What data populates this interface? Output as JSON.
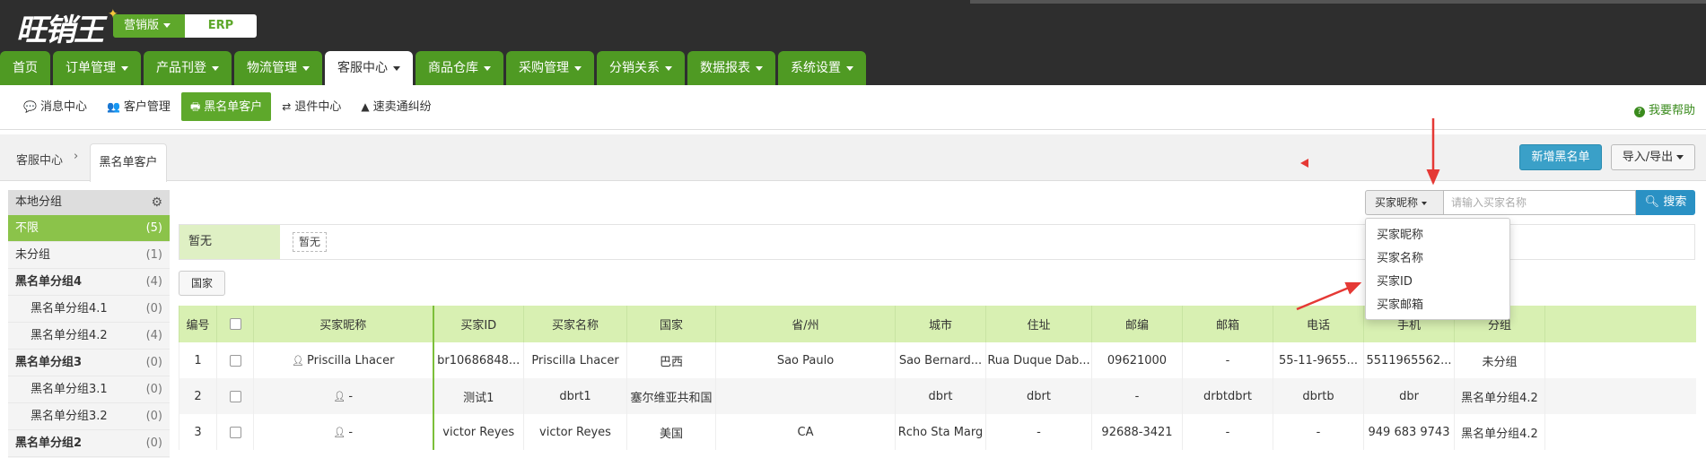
{
  "brand": {
    "logo_text": "旺销王",
    "edition": "营销版",
    "product": "ERP"
  },
  "main_nav": [
    {
      "label": "首页",
      "dropdown": false,
      "active": false
    },
    {
      "label": "订单管理",
      "dropdown": true,
      "active": false
    },
    {
      "label": "产品刊登",
      "dropdown": true,
      "active": false
    },
    {
      "label": "物流管理",
      "dropdown": true,
      "active": false
    },
    {
      "label": "客服中心",
      "dropdown": true,
      "active": true
    },
    {
      "label": "商品仓库",
      "dropdown": true,
      "active": false
    },
    {
      "label": "采购管理",
      "dropdown": true,
      "active": false
    },
    {
      "label": "分销关系",
      "dropdown": true,
      "active": false
    },
    {
      "label": "数据报表",
      "dropdown": true,
      "active": false
    },
    {
      "label": "系统设置",
      "dropdown": true,
      "active": false
    }
  ],
  "sub_nav": [
    {
      "label": "消息中心",
      "icon": "chat-bubbles-icon",
      "glyph": "💬",
      "active": false
    },
    {
      "label": "客户管理",
      "icon": "users-icon",
      "glyph": "👥",
      "active": false
    },
    {
      "label": "黑名单客户",
      "icon": "blacklist-icon",
      "glyph": "🖶",
      "active": true
    },
    {
      "label": "退件中心",
      "icon": "retweet-icon",
      "glyph": "⇄",
      "active": false
    },
    {
      "label": "速卖通纠纷",
      "icon": "warning-icon",
      "glyph": "▲",
      "active": false
    }
  ],
  "help_label": "我要帮助",
  "breadcrumb": {
    "root": "客服中心",
    "current": "黑名单客户"
  },
  "actions": {
    "add_blacklist": "新增黑名单",
    "import_export": "导入/导出"
  },
  "sidebar": {
    "title": "本地分组",
    "groups": [
      {
        "label": "不限",
        "count": "(5)",
        "level": 0,
        "bold": false,
        "active": true
      },
      {
        "label": "未分组",
        "count": "(1)",
        "level": 0,
        "bold": false,
        "active": false
      },
      {
        "label": "黑名单分组4",
        "count": "(4)",
        "level": 0,
        "bold": true,
        "active": false
      },
      {
        "label": "黑名单分组4.1",
        "count": "(0)",
        "level": 1,
        "bold": false,
        "active": false
      },
      {
        "label": "黑名单分组4.2",
        "count": "(4)",
        "level": 1,
        "bold": false,
        "active": false
      },
      {
        "label": "黑名单分组3",
        "count": "(0)",
        "level": 0,
        "bold": true,
        "active": false
      },
      {
        "label": "黑名单分组3.1",
        "count": "(0)",
        "level": 1,
        "bold": false,
        "active": false
      },
      {
        "label": "黑名单分组3.2",
        "count": "(0)",
        "level": 1,
        "bold": false,
        "active": false
      },
      {
        "label": "黑名单分组2",
        "count": "(0)",
        "level": 0,
        "bold": true,
        "active": false
      }
    ]
  },
  "search": {
    "field_selected": "买家昵称",
    "placeholder": "请输入买家名称",
    "button": "搜索",
    "options": [
      "买家昵称",
      "买家名称",
      "买家ID",
      "买家邮箱"
    ]
  },
  "filter": {
    "label": "暂无",
    "tag": "暂无",
    "country_button": "国家"
  },
  "table": {
    "columns": [
      "编号",
      "",
      "买家昵称",
      "买家ID",
      "买家名称",
      "国家",
      "省/州",
      "城市",
      "住址",
      "邮编",
      "邮箱",
      "电话",
      "手机",
      "分组"
    ],
    "rows": [
      [
        "1",
        "",
        "Priscilla Lhacer",
        "br10686848...",
        "Priscilla Lhacer",
        "巴西",
        "Sao Paulo",
        "Sao Bernard...",
        "Rua Duque Dab...",
        "09621000",
        "-",
        "55-11-9655...",
        "5511965562...",
        "未分组"
      ],
      [
        "2",
        "",
        "-",
        "测试1",
        "dbrt1",
        "塞尔维亚共和国",
        "",
        "dbrt",
        "dbrt",
        "-",
        "drbtdbrt",
        "dbrtb",
        "dbr",
        "黑名单分组4.2"
      ],
      [
        "3",
        "",
        "-",
        "victor Reyes",
        "victor Reyes",
        "美国",
        "CA",
        "Rcho Sta Marg",
        "-",
        "92688-3421",
        "-",
        "-",
        "949 683 9743",
        "黑名单分组4.2"
      ]
    ]
  },
  "colors": {
    "nav_green": "#4f9a23",
    "accent_green": "#5ea82b",
    "header_dark": "#2e2e2e",
    "table_header": "#d8f0b2",
    "primary_blue": "#3aa0c8",
    "annotation_red": "#e53935"
  }
}
